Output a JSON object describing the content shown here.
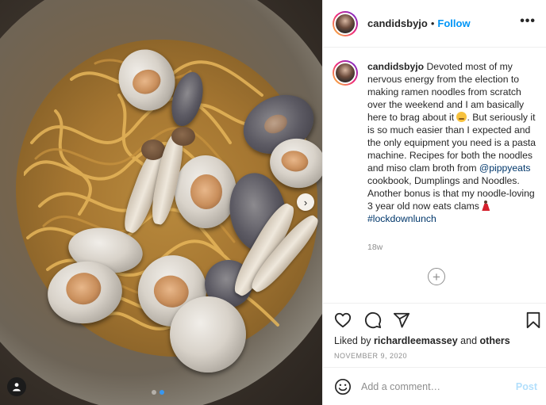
{
  "post": {
    "username": "candidsbyjo",
    "separator": "•",
    "follow_label": "Follow",
    "more_label": "•••",
    "caption": {
      "username": "candidsbyjo",
      "part1": "Devoted most of my nervous energy from the election to making ramen noodles from scratch over the weekend and I am basically here to brag about it",
      "part2": ". But seriously it is so much easier than I expected and the only equipment you need is a pasta machine. Recipes for both the noodles and miso clam broth from",
      "mention": "@pippyeats",
      "part3": "cookbook, Dumplings and Noodles. Another bonus is that my noodle-loving 3 year old now eats clams",
      "hashtag": "#lockdownlunch"
    },
    "time_ago": "18w",
    "load_more_label": "+",
    "likes_prefix": "Liked by",
    "liked_by_user": "richardleemassey",
    "likes_and": "and",
    "likes_others": "others",
    "date": "NOVEMBER 9, 2020",
    "comment_placeholder": "Add a comment…",
    "post_label": "Post"
  },
  "carousel": {
    "next_label": "›",
    "dots": 2,
    "active_dot": 1
  },
  "icons": {
    "like": "heart-icon",
    "comment": "comment-bubble-icon",
    "share": "paper-plane-icon",
    "save": "bookmark-icon",
    "emoji": "smiley-icon",
    "user_tag": "user-tag-icon"
  },
  "colors": {
    "follow": "#0095f6",
    "link": "#00376b",
    "muted": "#8e8e8e",
    "post_disabled": "#b2dffc",
    "active_dot": "#3897f0"
  }
}
